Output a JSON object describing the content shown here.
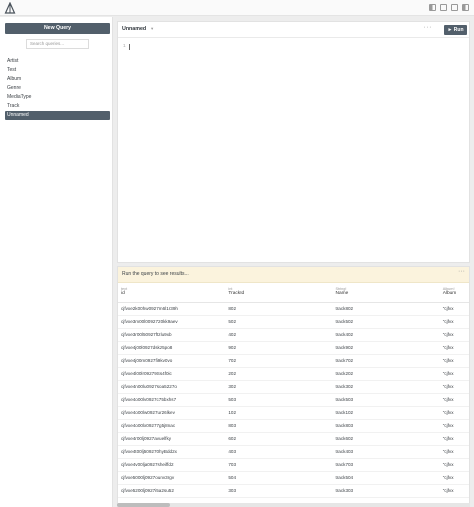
{
  "sidebar": {
    "new_query_label": "New Query",
    "search_placeholder": "Search queries...",
    "queries": [
      "Artist",
      "Test",
      "Album",
      "Genre",
      "MediaType",
      "Track",
      "Unnamed"
    ],
    "active_query": "Unnamed"
  },
  "editor": {
    "title": "Unnamed",
    "menu": "···",
    "run_label": "► Run",
    "line_number": "1"
  },
  "results": {
    "banner": "Run the query to see results...",
    "menu": "···",
    "columns": [
      {
        "type": "text",
        "name": "id"
      },
      {
        "type": "int",
        "name": "TrackId"
      },
      {
        "type": "String!",
        "name": "Name"
      },
      {
        "type": "Album!",
        "name": "Album"
      }
    ],
    "rows": [
      [
        "cjfvxe2k00hw0927m6l1r39h",
        "802",
        "track802",
        "\"cjfvx"
      ],
      [
        "cjfvxe3m00l0092720kk9aev",
        "502",
        "track502",
        "\"cjfvx"
      ],
      [
        "cjfvxe3r00l50927ftzlu9xb",
        "402",
        "track402",
        "\"cjfvx"
      ],
      [
        "cjfvxe4j00l0927dskz5po8",
        "902",
        "track902",
        "\"cjfvx"
      ],
      [
        "cjfvxe4j00m0927fi9kv0vo",
        "702",
        "track702",
        "\"cjfvx"
      ],
      [
        "cjfvxe4l00lr09279Ss4f0ic",
        "202",
        "track202",
        "\"cjfvx"
      ],
      [
        "cjfvxe4n00lu0927soa5227o",
        "302",
        "track302",
        "\"cjfvx"
      ],
      [
        "cjfvxe4o00lv0927c75bxhs7",
        "503",
        "track503",
        "\"cjfvx"
      ],
      [
        "cjfvxe4o00lw0927ur26lkev",
        "102",
        "track102",
        "\"cjfvx"
      ],
      [
        "cjfvxe4o00lx09277g5j8nac",
        "803",
        "track803",
        "\"cjfvx"
      ],
      [
        "cjfvxe4r00lj0927avuelfky",
        "602",
        "track602",
        "\"cjfvx"
      ],
      [
        "cjfvxe4t00lj509270hyBdd2x",
        "403",
        "track403",
        "\"cjfvx"
      ],
      [
        "cjfvxe4v00lja0927sheiffd2",
        "703",
        "track703",
        "\"cjfvx"
      ],
      [
        "cjfvxe5000lj0927ounv3rgv",
        "504",
        "track504",
        "\"cjfvx"
      ],
      [
        "cjfvxe5200lj0927i5a2su52",
        "303",
        "track303",
        "\"cjfvx"
      ]
    ]
  }
}
